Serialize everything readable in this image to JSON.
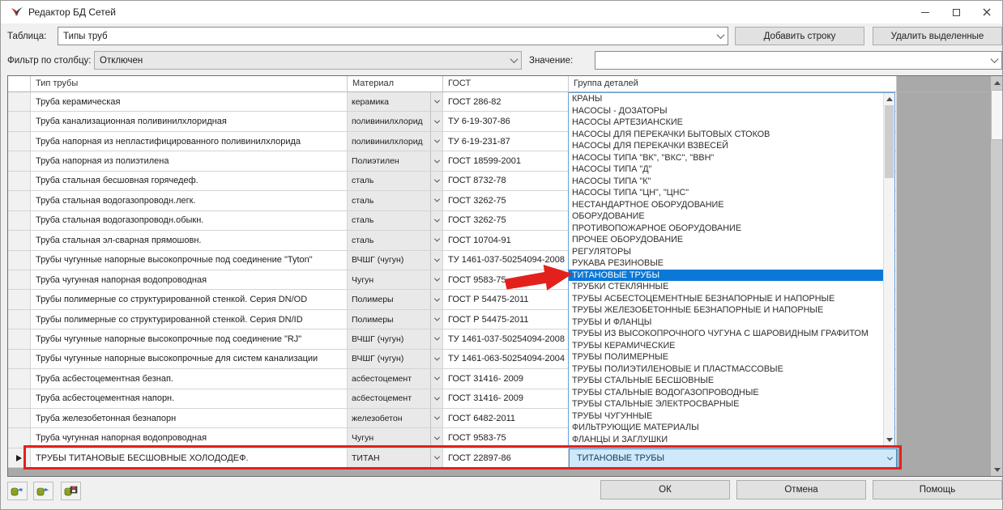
{
  "window": {
    "title": "Редактор БД Сетей"
  },
  "toolbar": {
    "table_label": "Таблица:",
    "table_value": "Типы труб",
    "add_row_label": "Добавить строку",
    "delete_label": "Удалить выделенные",
    "filter_label": "Фильтр по столбцу:",
    "filter_value": "Отключен",
    "value_label": "Значение:",
    "value_value": ""
  },
  "table": {
    "columns": {
      "type": "Тип трубы",
      "material": "Материал",
      "gost": "ГОСТ",
      "group": "Группа деталей"
    },
    "rows": [
      {
        "type": "Труба керамическая",
        "material": "керамика",
        "gost": "ГОСТ 286-82"
      },
      {
        "type": "Труба канализационная поливинилхлоридная",
        "material": "поливинилхлорид",
        "gost": "ТУ 6-19-307-86"
      },
      {
        "type": "Труба напорная из непластифицированного поливинилхлорида",
        "material": "поливинилхлорид",
        "gost": "ТУ 6-19-231-87"
      },
      {
        "type": "Труба напорная из полиэтилена",
        "material": "Полиэтилен",
        "gost": "ГОСТ 18599-2001"
      },
      {
        "type": "Труба стальная бесшовная горячедеф.",
        "material": "сталь",
        "gost": "ГОСТ 8732-78"
      },
      {
        "type": "Труба стальная водогазопроводн.легк.",
        "material": "сталь",
        "gost": "ГОСТ 3262-75"
      },
      {
        "type": "Труба стальная водогазопроводн.обыкн.",
        "material": "сталь",
        "gost": "ГОСТ 3262-75"
      },
      {
        "type": "Труба стальная эл-сварная прямошовн.",
        "material": "сталь",
        "gost": "ГОСТ 10704-91"
      },
      {
        "type": "Трубы чугунные напорные высокопрочные под соединение \"Tyton\"",
        "material": "ВЧШГ (чугун)",
        "gost": "ТУ 1461-037-50254094-2008"
      },
      {
        "type": "Труба чугунная напорная водопроводная",
        "material": "Чугун",
        "gost": "ГОСТ 9583-75"
      },
      {
        "type": "Трубы полимерные со структурированной стенкой. Серия DN/OD",
        "material": "Полимеры",
        "gost": "ГОСТ Р 54475-2011"
      },
      {
        "type": "Трубы полимерные со структурированной стенкой. Серия DN/ID",
        "material": "Полимеры",
        "gost": "ГОСТ Р 54475-2011"
      },
      {
        "type": "Трубы чугунные напорные высокопрочные под соединение \"RJ\"",
        "material": "ВЧШГ (чугун)",
        "gost": "ТУ 1461-037-50254094-2008"
      },
      {
        "type": "Трубы чугунные напорные высокопрочные для систем канализации",
        "material": "ВЧШГ (чугун)",
        "gost": "ТУ 1461-063-50254094-2004"
      },
      {
        "type": "Труба асбестоцементная безнап.",
        "material": "асбестоцемент",
        "gost": "ГОСТ 31416- 2009"
      },
      {
        "type": "Труба асбестоцементная напорн.",
        "material": "асбестоцемент",
        "gost": "ГОСТ 31416- 2009"
      },
      {
        "type": "Труба железобетонная безнапорн",
        "material": "железобетон",
        "gost": "ГОСТ 6482-2011"
      },
      {
        "type": "Труба чугунная напорная водопроводная",
        "material": "Чугун",
        "gost": "ГОСТ 9583-75"
      }
    ],
    "selected_row": {
      "type": "ТРУБЫ ТИТАНОВЫЕ БЕСШОВНЫЕ ХОЛОДОДЕФ.",
      "material": "ТИТАН",
      "gost": "ГОСТ 22897-86",
      "group": "ТИТАНОВЫЕ ТРУБЫ"
    }
  },
  "dropdown": {
    "selected_index": 15,
    "items": [
      "КРАНЫ",
      "НАСОСЫ - ДОЗАТОРЫ",
      "НАСОСЫ АРТЕЗИАНСКИЕ",
      "НАСОСЫ ДЛЯ ПЕРЕКАЧКИ БЫТОВЫХ СТОКОВ",
      "НАСОСЫ ДЛЯ ПЕРЕКАЧКИ ВЗВЕСЕЙ",
      "НАСОСЫ ТИПА \"ВК\", \"ВКС\", \"ВВН\"",
      "НАСОСЫ ТИПА \"Д\"",
      "НАСОСЫ ТИПА \"К\"",
      "НАСОСЫ ТИПА \"ЦН\", \"ЦНС\"",
      "НЕСТАНДАРТНОЕ ОБОРУДОВАНИЕ",
      "ОБОРУДОВАНИЕ",
      "ПРОТИВОПОЖАРНОЕ ОБОРУДОВАНИЕ",
      "ПРОЧЕЕ ОБОРУДОВАНИЕ",
      "РЕГУЛЯТОРЫ",
      "РУКАВА РЕЗИНОВЫЕ",
      "ТИТАНОВЫЕ ТРУБЫ",
      "ТРУБКИ СТЕКЛЯННЫЕ",
      "ТРУБЫ АСБЕСТОЦЕМЕНТНЫЕ БЕЗНАПОРНЫЕ И НАПОРНЫЕ",
      "ТРУБЫ ЖЕЛЕЗОБЕТОННЫЕ БЕЗНАПОРНЫЕ И НАПОРНЫЕ",
      "ТРУБЫ И ФЛАНЦЫ",
      "ТРУБЫ ИЗ ВЫСОКОПРОЧНОГО ЧУГУНА С ШАРОВИДНЫМ ГРАФИТОМ",
      "ТРУБЫ КЕРАМИЧЕСКИЕ",
      "ТРУБЫ ПОЛИМЕРНЫЕ",
      "ТРУБЫ ПОЛИЭТИЛЕНОВЫЕ И ПЛАСТМАССОВЫЕ",
      "ТРУБЫ СТАЛЬНЫЕ БЕСШОВНЫЕ",
      "ТРУБЫ СТАЛЬНЫЕ ВОДОГАЗОПРОВОДНЫЕ",
      "ТРУБЫ СТАЛЬНЫЕ ЭЛЕКТРОСВАРНЫЕ",
      "ТРУБЫ ЧУГУННЫЕ",
      "ФИЛЬТРУЮЩИЕ МАТЕРИАЛЫ",
      "ФЛАНЦЫ И ЗАГЛУШКИ"
    ]
  },
  "footer": {
    "ok_label": "ОК",
    "cancel_label": "Отмена",
    "help_label": "Помощь",
    "icons": [
      "db-undo-icon",
      "db-redo-icon",
      "db-save-icon"
    ]
  },
  "colors": {
    "accent_blue": "#0a78d7",
    "selection_fill": "#cfe8fa",
    "annotation_red": "#e3211c"
  }
}
